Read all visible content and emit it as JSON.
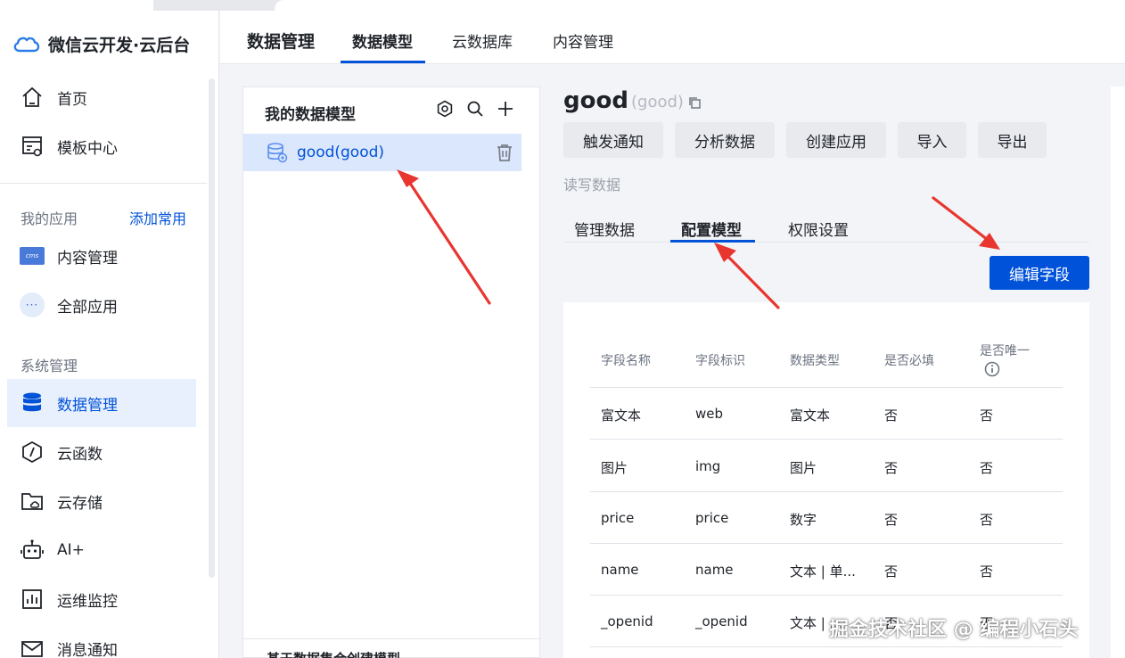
{
  "brand": {
    "title": "微信云开发·云后台"
  },
  "sidebar": {
    "items_top": [
      {
        "label": "首页",
        "icon": "home-icon"
      },
      {
        "label": "模板中心",
        "icon": "template-icon"
      }
    ],
    "my_apps_label": "我的应用",
    "add_common_label": "添加常用",
    "apps": [
      {
        "label": "内容管理",
        "icon": "cms-icon",
        "icon_text": "cms"
      },
      {
        "label": "全部应用",
        "icon": "more-dots-icon",
        "icon_text": "···"
      }
    ],
    "system_label": "系统管理",
    "system_items": [
      {
        "label": "数据管理",
        "icon": "database-icon",
        "active": true
      },
      {
        "label": "云函数",
        "icon": "function-icon"
      },
      {
        "label": "云存储",
        "icon": "storage-folder-icon"
      },
      {
        "label": "AI+",
        "icon": "robot-icon"
      },
      {
        "label": "运维监控",
        "icon": "chart-monitor-icon"
      },
      {
        "label": "消息通知",
        "icon": "message-icon"
      }
    ]
  },
  "topnav": {
    "title": "数据管理",
    "tabs": [
      {
        "label": "数据模型",
        "active": true
      },
      {
        "label": "云数据库"
      },
      {
        "label": "内容管理"
      }
    ]
  },
  "model_panel": {
    "header": "我的数据模型",
    "icons": [
      "settings-icon",
      "search-icon",
      "add-icon"
    ],
    "models": [
      {
        "label": "good(good)",
        "selected": true
      }
    ],
    "footer": "基于数据集合创建模型"
  },
  "model": {
    "name": "good",
    "identifier": "(good)",
    "actions": [
      "触发通知",
      "分析数据",
      "创建应用",
      "导入",
      "导出"
    ],
    "rw_label": "读写数据",
    "subtabs": [
      {
        "label": "管理数据"
      },
      {
        "label": "配置模型",
        "active": true
      },
      {
        "label": "权限设置"
      }
    ],
    "edit_fields_label": "编辑字段"
  },
  "table": {
    "headers": [
      "字段名称",
      "字段标识",
      "数据类型",
      "是否必填",
      "是否唯一"
    ],
    "rows": [
      [
        "富文本",
        "web",
        "富文本",
        "否",
        "否"
      ],
      [
        "图片",
        "img",
        "图片",
        "否",
        "否"
      ],
      [
        "price",
        "price",
        "数字",
        "否",
        "否"
      ],
      [
        "name",
        "name",
        "文本 | 单...",
        "否",
        "否"
      ],
      [
        "_openid",
        "_openid",
        "文本 | ...",
        "否",
        "否"
      ]
    ]
  },
  "colors": {
    "accent": "#0052d9",
    "arrow": "#e8362f",
    "active_bg": "#e8f0fd"
  },
  "watermark": "掘金技术社区 @ 编程小石头"
}
